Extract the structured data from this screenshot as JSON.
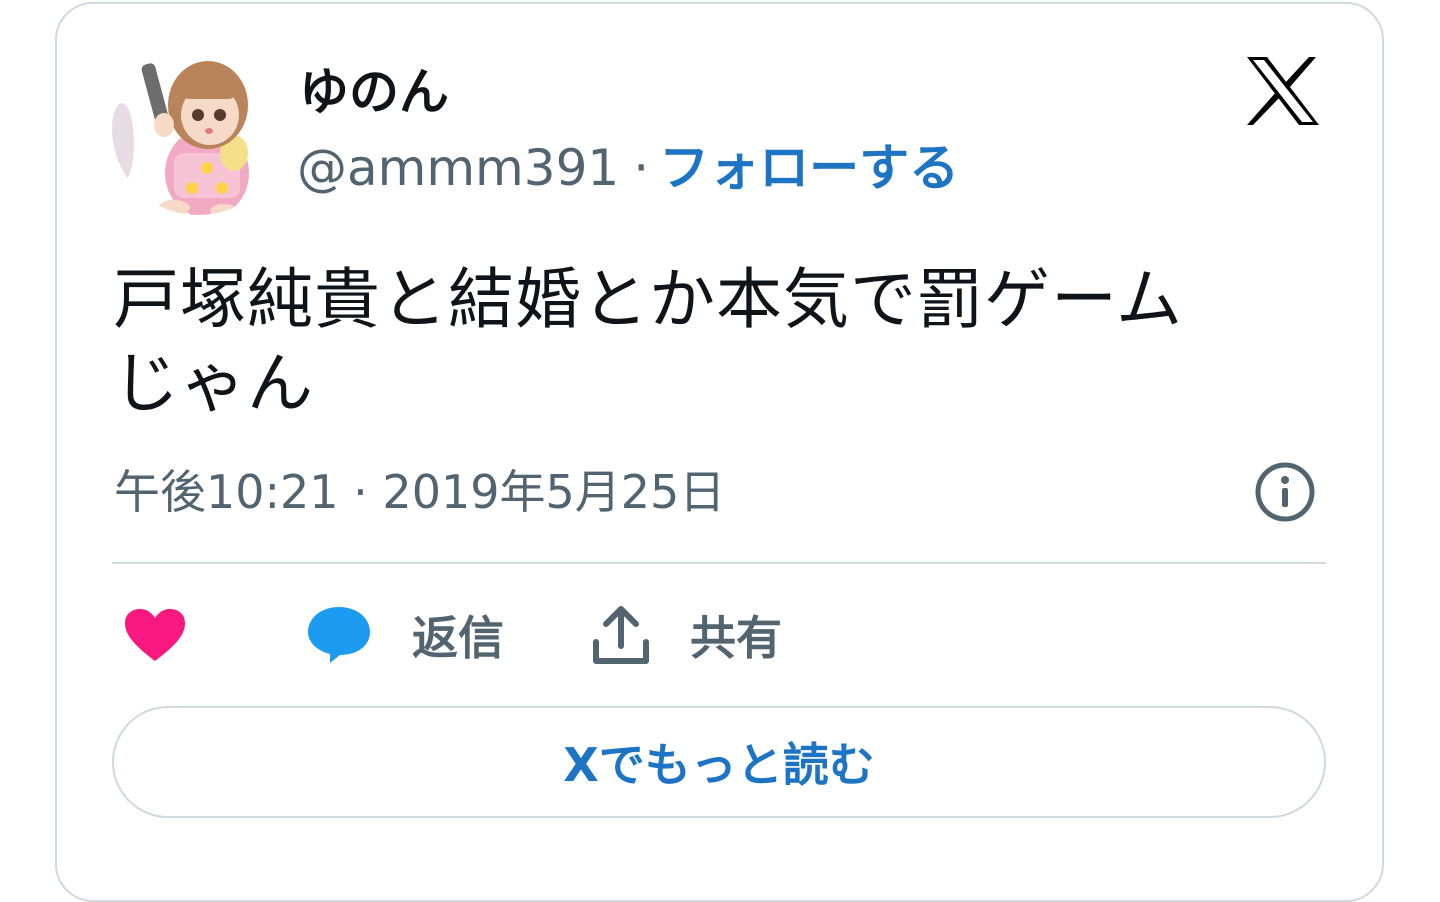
{
  "user": {
    "display_name": "ゆのん",
    "handle": "@ammm391",
    "separator": "·",
    "follow_label": "フォローする"
  },
  "tweet": {
    "text_line1": "戸塚純貴と結婚とか本気で罰ゲーム",
    "text_line2": "じゃん",
    "timestamp": "午後10:21 · 2019年5月25日"
  },
  "actions": {
    "reply_label": "返信",
    "share_label": "共有"
  },
  "read_more_label": "Xでもっと読む",
  "icons": [
    "x-logo-icon",
    "info-icon",
    "heart-icon",
    "reply-bubble-icon",
    "share-upload-icon"
  ],
  "colors": {
    "accent": "#1d74c4",
    "heart": "#f91880",
    "reply": "#1d9bf0",
    "secondary_text": "#536471",
    "border": "#cfd9de"
  }
}
